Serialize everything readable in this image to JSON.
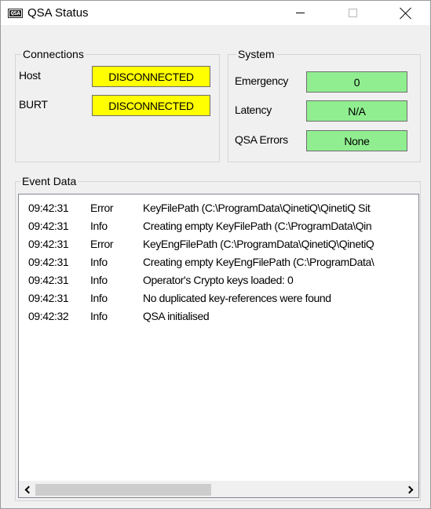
{
  "window": {
    "title": "QSA Status",
    "icon_text": "QSA"
  },
  "connections": {
    "title": "Connections",
    "items": [
      {
        "label": "Host",
        "status": "DISCONNECTED",
        "color": "#ffff00"
      },
      {
        "label": "BURT",
        "status": "DISCONNECTED",
        "color": "#ffff00"
      }
    ]
  },
  "system": {
    "title": "System",
    "items": [
      {
        "label": "Emergency",
        "value": "0",
        "color": "#90ee90"
      },
      {
        "label": "Latency",
        "value": "N/A",
        "color": "#90ee90"
      },
      {
        "label": "QSA Errors",
        "value": "None",
        "color": "#90ee90"
      }
    ]
  },
  "event_data": {
    "title": "Event Data",
    "rows": [
      {
        "time": "09:42:31",
        "level": "Error",
        "message": "KeyFilePath (C:\\ProgramData\\QinetiQ\\QinetiQ Sit"
      },
      {
        "time": "09:42:31",
        "level": "Info",
        "message": "Creating empty KeyFilePath (C:\\ProgramData\\Qin"
      },
      {
        "time": "09:42:31",
        "level": "Error",
        "message": "KeyEngFilePath (C:\\ProgramData\\QinetiQ\\QinetiQ"
      },
      {
        "time": "09:42:31",
        "level": "Info",
        "message": "Creating empty KeyEngFilePath (C:\\ProgramData\\"
      },
      {
        "time": "09:42:31",
        "level": "Info",
        "message": "Operator's Crypto keys loaded: 0"
      },
      {
        "time": "09:42:31",
        "level": "Info",
        "message": "No duplicated key-references were found"
      },
      {
        "time": "09:42:32",
        "level": "Info",
        "message": "QSA initialised"
      }
    ]
  },
  "icons": [
    "app-icon",
    "minimize-icon",
    "maximize-icon",
    "close-icon",
    "scroll-left-icon",
    "scroll-right-icon"
  ]
}
